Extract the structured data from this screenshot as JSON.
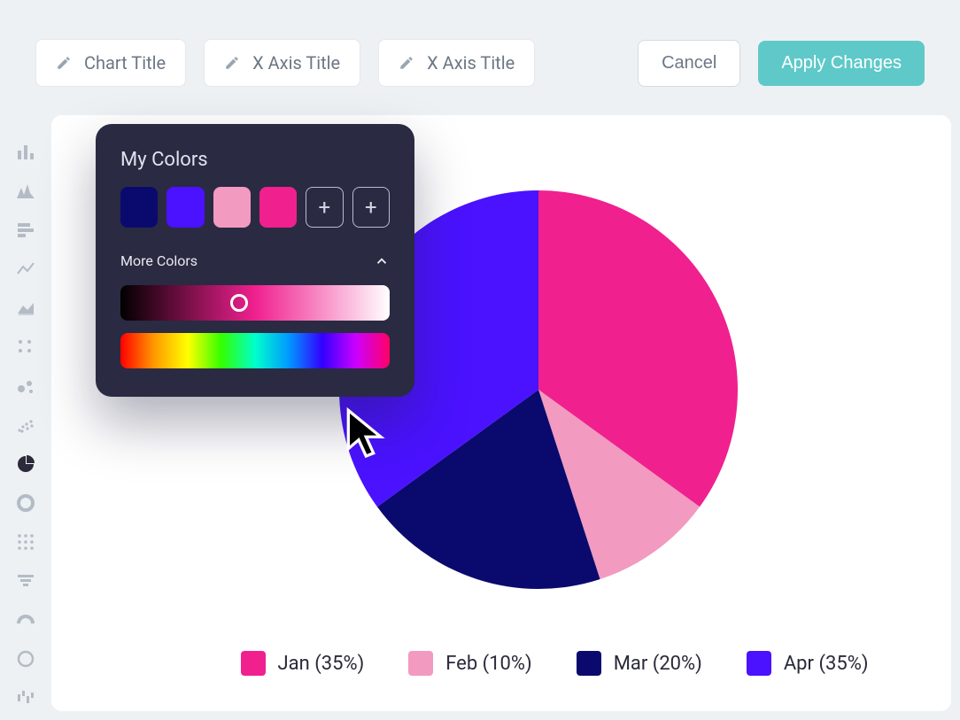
{
  "toolbar": {
    "chart_title": "Chart Title",
    "x_axis_title_1": "X Axis Title",
    "x_axis_title_2": "X Axis Title",
    "cancel_label": "Cancel",
    "apply_label": "Apply Changes"
  },
  "picker": {
    "my_colors_label": "My Colors",
    "more_colors_label": "More Colors",
    "swatches": [
      "#0a0a6e",
      "#4a12ff",
      "#f29abf",
      "#f0208f"
    ]
  },
  "legend": [
    {
      "label": "Jan (35%)",
      "color": "#f0208f"
    },
    {
      "label": "Feb (10%)",
      "color": "#f29abf"
    },
    {
      "label": "Mar (20%)",
      "color": "#0a0a6e"
    },
    {
      "label": "Apr (35%)",
      "color": "#4a12ff"
    }
  ],
  "chart_data": {
    "type": "pie",
    "title": "",
    "series": [
      {
        "name": "Jan",
        "value": 35,
        "color": "#f0208f"
      },
      {
        "name": "Feb",
        "value": 10,
        "color": "#f29abf"
      },
      {
        "name": "Mar",
        "value": 20,
        "color": "#0a0a6e"
      },
      {
        "name": "Apr",
        "value": 35,
        "color": "#4a12ff"
      }
    ]
  },
  "rail": {
    "selected": "pie"
  }
}
